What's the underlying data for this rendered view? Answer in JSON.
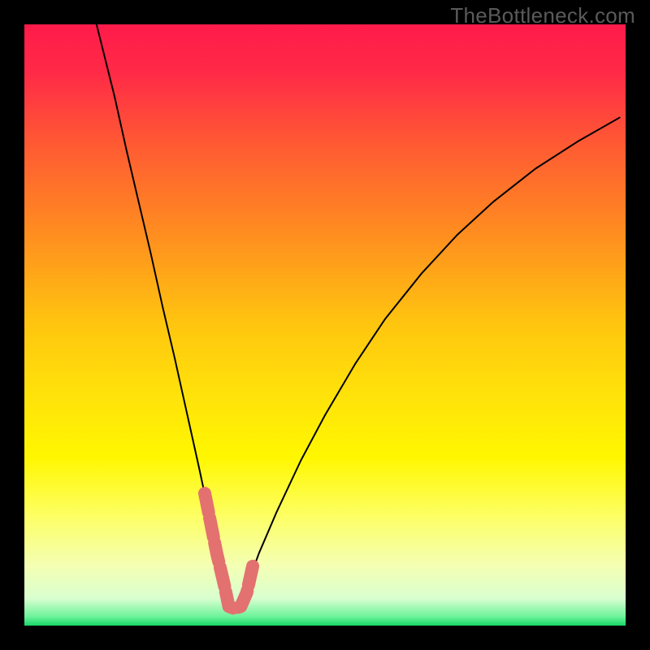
{
  "watermark": "TheBottleneck.com",
  "chart_data": {
    "type": "line",
    "title": "",
    "xlabel": "",
    "ylabel": "",
    "xlim": [
      0,
      100
    ],
    "ylim": [
      0,
      100
    ],
    "background_gradient": {
      "stops": [
        {
          "offset": 0.0,
          "color": "#ff1b4a"
        },
        {
          "offset": 0.08,
          "color": "#ff2a47"
        },
        {
          "offset": 0.2,
          "color": "#ff5a33"
        },
        {
          "offset": 0.35,
          "color": "#ff8e1f"
        },
        {
          "offset": 0.5,
          "color": "#ffc60f"
        },
        {
          "offset": 0.62,
          "color": "#ffe30a"
        },
        {
          "offset": 0.72,
          "color": "#fff700"
        },
        {
          "offset": 0.82,
          "color": "#fdff66"
        },
        {
          "offset": 0.9,
          "color": "#f4ffb3"
        },
        {
          "offset": 0.955,
          "color": "#d9ffd0"
        },
        {
          "offset": 0.985,
          "color": "#6df39a"
        },
        {
          "offset": 1.0,
          "color": "#17d867"
        }
      ]
    },
    "series": [
      {
        "name": "bottleneck-curve",
        "stroke": "#000000",
        "strokeWidth": 2,
        "x": [
          12.0,
          13.5,
          15.0,
          17.0,
          19.0,
          21.0,
          23.0,
          25.0,
          27.0,
          29.0,
          30.5,
          32.0,
          33.5,
          35.0,
          37.0,
          39.0,
          42.0,
          46.0,
          50.0,
          55.0,
          60.0,
          66.0,
          72.0,
          78.0,
          85.0,
          92.0,
          99.0
        ],
        "y": [
          100.0,
          94.0,
          88.0,
          79.0,
          70.5,
          62.0,
          53.0,
          44.5,
          35.5,
          26.5,
          19.5,
          12.5,
          6.5,
          3.0,
          6.5,
          12.0,
          19.0,
          27.5,
          35.0,
          43.5,
          51.0,
          58.5,
          65.0,
          70.5,
          76.0,
          80.5,
          84.5
        ]
      },
      {
        "name": "highlight-band",
        "stroke": "#e37170",
        "strokeWidth": 16,
        "x": [
          30.0,
          31.0,
          32.0,
          33.2,
          34.0,
          35.0,
          36.0,
          37.0,
          38.0
        ],
        "y": [
          22.0,
          17.0,
          12.0,
          7.0,
          3.2,
          2.8,
          3.2,
          5.5,
          10.0
        ],
        "dashPattern": "24 7"
      }
    ]
  }
}
